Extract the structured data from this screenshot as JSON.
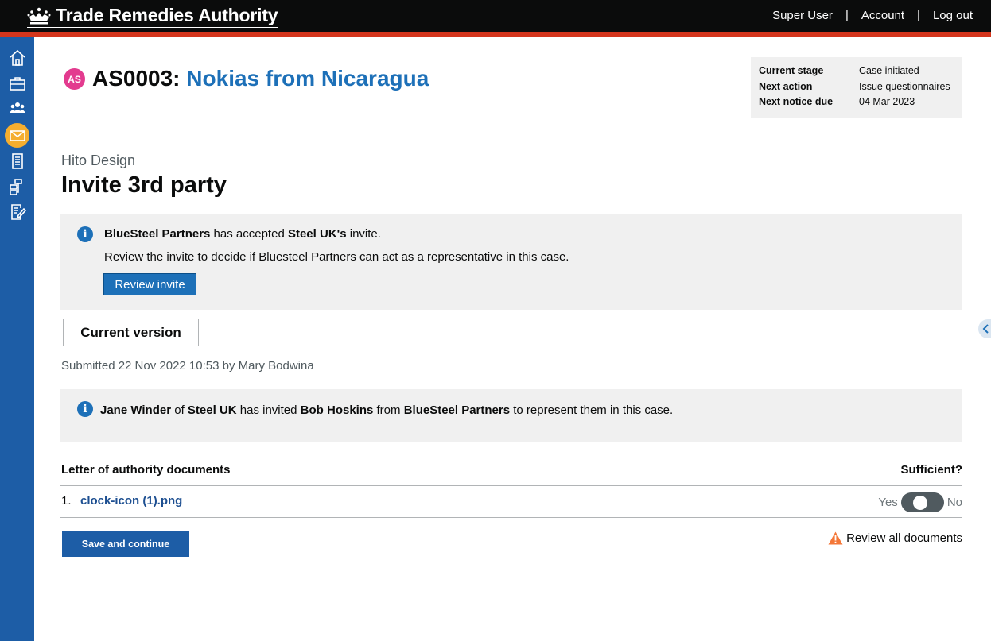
{
  "header": {
    "title": "Trade Remedies Authority",
    "nav": [
      "Super User",
      "Account",
      "Log out"
    ],
    "separator": "|"
  },
  "sidebar": {
    "items": [
      "home-icon",
      "briefcase-icon",
      "people-icon",
      "mail-icon",
      "document-icon",
      "sitemap-icon",
      "edit-document-icon"
    ],
    "active": "mail-icon"
  },
  "case": {
    "avatar": "AS",
    "reference": "AS0003:",
    "name": "Nokias from Nicaragua"
  },
  "stage": {
    "rows": [
      {
        "label": "Current stage",
        "value": "Case initiated"
      },
      {
        "label": "Next action",
        "value": "Issue questionnaires"
      },
      {
        "label": "Next notice due",
        "value": "04 Mar 2023"
      }
    ]
  },
  "page": {
    "caption": "Hito Design",
    "title": "Invite 3rd party"
  },
  "notice1": {
    "party": "BlueSteel Partners",
    "mid": " has accepted ",
    "inviter": "Steel UK's",
    "end": " invite.",
    "line2": "Review the invite to decide if Bluesteel Partners can act as a representative in this case.",
    "button": "Review invite"
  },
  "tabs": [
    {
      "label": "Current version"
    }
  ],
  "submitted": "Submitted 22 Nov 2022 10:53 by Mary Bodwina",
  "notice2": {
    "p1": "Jane Winder",
    "t1": " of ",
    "p2": "Steel UK",
    "t2": " has invited ",
    "p3": "Bob Hoskins",
    "t3": " from ",
    "p4": "BlueSteel Partners",
    "t4": " to represent them in this case."
  },
  "documents": {
    "heading": "Letter of authority documents",
    "sufficient_heading": "Sufficient?",
    "items": [
      {
        "number": "1.",
        "name": "clock-icon (1).png"
      }
    ],
    "yes_label": "Yes",
    "no_label": "No"
  },
  "actions": {
    "save": "Save and continue",
    "review_all": "Review all documents"
  },
  "colors": {
    "brand_blue": "#1d70b8",
    "sidebar_blue": "#1d5da6",
    "header_black": "#0b0c0c",
    "header_red": "#d4351c",
    "active_icon": "#f5ae2f",
    "avatar": "#e33b8f",
    "warning": "#f47738"
  }
}
